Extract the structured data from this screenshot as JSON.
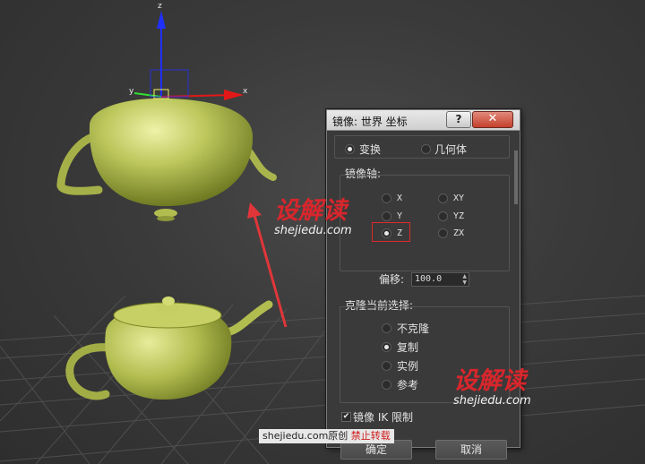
{
  "dialog": {
    "title": "镜像: 世界 坐标",
    "help_label": "?",
    "close_label": "✕",
    "transform_mode": {
      "options": [
        {
          "label": "变换",
          "selected": true
        },
        {
          "label": "几何体",
          "selected": false
        }
      ]
    },
    "mirror_axis": {
      "heading": "镜像轴:",
      "axes": [
        {
          "label": "X",
          "selected": false
        },
        {
          "label": "XY",
          "selected": false
        },
        {
          "label": "Y",
          "selected": false
        },
        {
          "label": "YZ",
          "selected": false
        },
        {
          "label": "Z",
          "selected": true
        },
        {
          "label": "ZX",
          "selected": false
        }
      ],
      "offset_label": "偏移:",
      "offset_value": "100.0"
    },
    "clone": {
      "heading": "克隆当前选择:",
      "options": [
        {
          "label": "不克隆",
          "selected": false
        },
        {
          "label": "复制",
          "selected": true
        },
        {
          "label": "实例",
          "selected": false
        },
        {
          "label": "参考",
          "selected": false
        }
      ]
    },
    "mirror_ik": {
      "checked": true,
      "label": "镜像 IK 限制"
    },
    "ok_label": "确定",
    "cancel_label": "取消"
  },
  "gizmo": {
    "x": "x",
    "y": "y",
    "z": "z"
  },
  "watermarks": [
    {
      "brand": "设解读",
      "url": "shejiedu.com"
    },
    {
      "brand": "设解读",
      "url": "shejiedu.com"
    }
  ],
  "credit": {
    "site": "shejiedu.com",
    "orig": "原创",
    "forbid": "禁止转载"
  },
  "colors": {
    "teapot": "#b9c45a",
    "highlight_box": "#e0282e",
    "arrow": "#e0363a",
    "viewport_bg": "#3a3a3a"
  }
}
